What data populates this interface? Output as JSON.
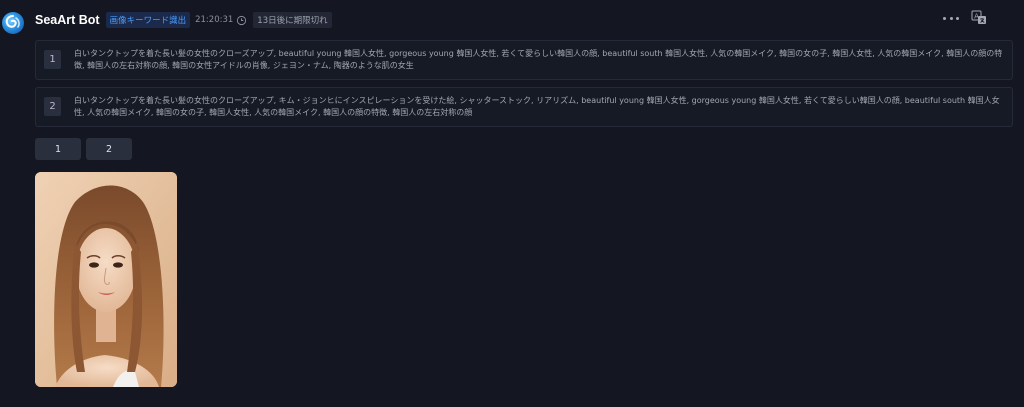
{
  "bot": {
    "name": "SeaArt Bot",
    "tag": "画像キーワード識出",
    "time": "21:20:31",
    "expiry": "13日後に期限切れ"
  },
  "icons": {
    "avatar": "seaart-logo-icon",
    "clock": "clock-icon",
    "more": "more-horizontal-icon",
    "translate": "translate-icon"
  },
  "prompts": [
    {
      "number": "1",
      "text": "白いタンクトップを着た長い髪の女性のクローズアップ, beautiful young 韓国人女性, gorgeous young 韓国人女性, 若くて愛らしい韓国人の顔, beautiful south 韓国人女性, 人気の韓国メイク, 韓国の女の子, 韓国人女性, 人気の韓国メイク, 韓国人の顔の特徴, 韓国人の左右対称の顔, 韓国の女性アイドルの肖像, ジェヨン・ナム, 陶器のような肌の女生"
    },
    {
      "number": "2",
      "text": "白いタンクトップを着た長い髪の女性のクローズアップ, キム・ジョンヒにインスピレーションを受けた絵, シャッターストック, リアリズム, beautiful young 韓国人女性, gorgeous young 韓国人女性, 若くて愛らしい韓国人の顔, beautiful south 韓国人女性, 人気の韓国メイク, 韓国の女の子, 韓国人女性, 人気の韓国メイク, 韓国人の顔の特徴, 韓国人の左右対称の顔"
    }
  ],
  "page_buttons": [
    "1",
    "2"
  ],
  "colors": {
    "background": "#141722",
    "accent": "#4a9cff"
  }
}
